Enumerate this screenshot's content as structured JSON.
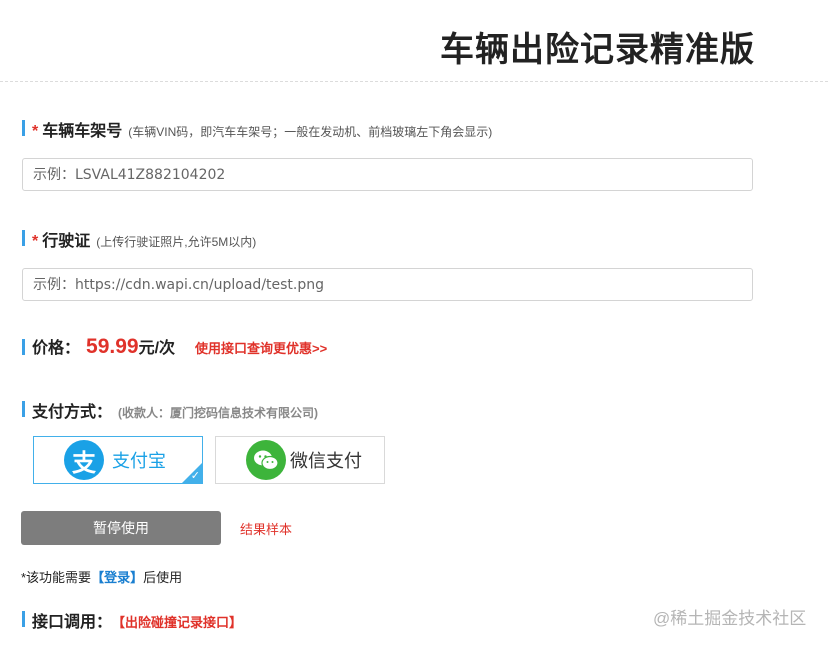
{
  "header": {
    "title": "车辆出险记录精准版"
  },
  "vin": {
    "required_mark": "*",
    "label": "车辆车架号",
    "hint": "(车辆VIN码，即汽车车架号；一般在发动机、前档玻璃左下角会显示)",
    "placeholder": "示例：LSVAL41Z882104202",
    "value": ""
  },
  "license": {
    "required_mark": "*",
    "label": "行驶证",
    "hint": "(上传行驶证照片,允许5M以内)",
    "placeholder": "示例：https://cdn.wapi.cn/upload/test.png",
    "value": ""
  },
  "price": {
    "label": "价格：",
    "value": "59.99",
    "unit": "元/次",
    "promo_link": "使用接口查询更优惠>>"
  },
  "payment": {
    "label": "支付方式：",
    "payee_hint": "(收款人：厦门挖码信息技术有限公司)",
    "options": [
      {
        "name": "支付宝",
        "icon": "alipay-icon",
        "icon_glyph": "支",
        "selected": true,
        "color": "#1aa1e6"
      },
      {
        "name": "微信支付",
        "icon": "wechat-icon",
        "selected": false,
        "color": "#3db43b"
      }
    ]
  },
  "actions": {
    "pause_button": "暂停使用",
    "sample_link": "结果样本"
  },
  "notice": {
    "prefix": "*该功能需要",
    "login_link": "【登录】",
    "suffix": "后使用"
  },
  "api": {
    "label": "接口调用：",
    "link": "【出险碰撞记录接口】"
  },
  "watermark": "@稀土掘金技术社区",
  "colors": {
    "accent": "#3aa0e6",
    "price": "#e0322a",
    "alipay": "#1aa1e6",
    "wechat": "#3db43b",
    "button_disabled": "#7d7d7d"
  }
}
